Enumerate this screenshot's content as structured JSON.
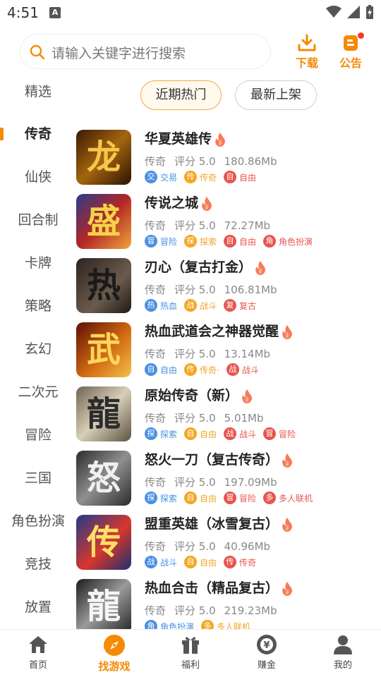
{
  "status_bar": {
    "time": "4:51",
    "notif_letter": "A"
  },
  "header": {
    "search_placeholder": "请输入关键字进行搜索",
    "download_label": "下载",
    "notice_label": "公告",
    "accent_color": "#F58A07"
  },
  "sidebar": {
    "items": [
      {
        "label": "精选",
        "active": false
      },
      {
        "label": "传奇",
        "active": true
      },
      {
        "label": "仙侠",
        "active": false
      },
      {
        "label": "回合制",
        "active": false
      },
      {
        "label": "卡牌",
        "active": false
      },
      {
        "label": "策略",
        "active": false
      },
      {
        "label": "玄幻",
        "active": false
      },
      {
        "label": "二次元",
        "active": false
      },
      {
        "label": "冒险",
        "active": false
      },
      {
        "label": "三国",
        "active": false
      },
      {
        "label": "角色扮演",
        "active": false
      },
      {
        "label": "竞技",
        "active": false
      },
      {
        "label": "放置",
        "active": false
      }
    ]
  },
  "tabs": {
    "hot": "近期热门",
    "new": "最新上架"
  },
  "games": [
    {
      "name": "华夏英雄传",
      "category": "传奇",
      "rating": "评分 5.0",
      "size": "180.86Mb",
      "icon_glyph": "龙",
      "tags": [
        {
          "badge": "交",
          "label": "交易",
          "color": "#4A90E2"
        },
        {
          "badge": "传",
          "label": "传奇",
          "color": "#F5A623"
        },
        {
          "badge": "自",
          "label": "自由",
          "color": "#E8554E"
        }
      ]
    },
    {
      "name": "传说之城",
      "category": "传奇",
      "rating": "评分 5.0",
      "size": "72.27Mb",
      "icon_glyph": "盛",
      "tags": [
        {
          "badge": "冒",
          "label": "冒险",
          "color": "#4A90E2"
        },
        {
          "badge": "探",
          "label": "探索",
          "color": "#F5A623"
        },
        {
          "badge": "自",
          "label": "自由",
          "color": "#E8554E"
        },
        {
          "badge": "角",
          "label": "角色扮演",
          "color": "#E8554E"
        }
      ]
    },
    {
      "name": "刃心（复古打金）",
      "category": "传奇",
      "rating": "评分 5.0",
      "size": "106.81Mb",
      "icon_glyph": "热",
      "tags": [
        {
          "badge": "热",
          "label": "热血",
          "color": "#4A90E2"
        },
        {
          "badge": "战",
          "label": "战斗",
          "color": "#F5A623"
        },
        {
          "badge": "复",
          "label": "复古",
          "color": "#E8554E"
        }
      ]
    },
    {
      "name": "热血武道会之神器觉醒",
      "category": "传奇",
      "rating": "评分 5.0",
      "size": "13.14Mb",
      "icon_glyph": "武",
      "tags": [
        {
          "badge": "自",
          "label": "自由",
          "color": "#4A90E2"
        },
        {
          "badge": "传",
          "label": "传奇·",
          "color": "#F5A623"
        },
        {
          "badge": "战",
          "label": "战斗",
          "color": "#E8554E"
        }
      ]
    },
    {
      "name": "原始传奇（新）",
      "category": "传奇",
      "rating": "评分 5.0",
      "size": "5.01Mb",
      "icon_glyph": "龍",
      "tags": [
        {
          "badge": "探",
          "label": "探索",
          "color": "#4A90E2"
        },
        {
          "badge": "自",
          "label": "自由",
          "color": "#F5A623"
        },
        {
          "badge": "战",
          "label": "战斗",
          "color": "#E8554E"
        },
        {
          "badge": "冒",
          "label": "冒险",
          "color": "#E8554E"
        }
      ]
    },
    {
      "name": "怒火一刀（复古传奇）",
      "category": "传奇",
      "rating": "评分 5.0",
      "size": "197.09Mb",
      "icon_glyph": "怒",
      "tags": [
        {
          "badge": "探",
          "label": "探索",
          "color": "#4A90E2"
        },
        {
          "badge": "自",
          "label": "自由",
          "color": "#F5A623"
        },
        {
          "badge": "冒",
          "label": "冒险",
          "color": "#E8554E"
        },
        {
          "badge": "多",
          "label": "多人联机",
          "color": "#E8554E"
        }
      ]
    },
    {
      "name": "盟重英雄（冰雪复古）",
      "category": "传奇",
      "rating": "评分 5.0",
      "size": "40.96Mb",
      "icon_glyph": "传",
      "tags": [
        {
          "badge": "战",
          "label": "战斗",
          "color": "#4A90E2"
        },
        {
          "badge": "自",
          "label": "自由",
          "color": "#F5A623"
        },
        {
          "badge": "传",
          "label": "传奇",
          "color": "#E8554E"
        }
      ]
    },
    {
      "name": "热血合击（精品复古）",
      "category": "传奇",
      "rating": "评分 5.0",
      "size": "219.23Mb",
      "icon_glyph": "龍",
      "tags": [
        {
          "badge": "角",
          "label": "角色扮演",
          "color": "#4A90E2"
        },
        {
          "badge": "多",
          "label": "多人联机",
          "color": "#F5A623"
        }
      ]
    }
  ],
  "bottom_nav": [
    {
      "label": "首页",
      "icon": "home-icon",
      "active": false
    },
    {
      "label": "找游戏",
      "icon": "compass-icon",
      "active": true
    },
    {
      "label": "福利",
      "icon": "gift-icon",
      "active": false
    },
    {
      "label": "赚金",
      "icon": "coin-icon",
      "active": false
    },
    {
      "label": "我的",
      "icon": "user-icon",
      "active": false
    }
  ]
}
